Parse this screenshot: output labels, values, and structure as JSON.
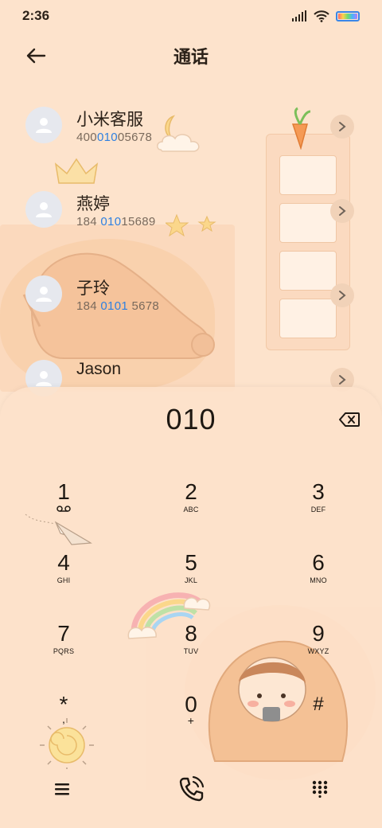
{
  "status_bar": {
    "time": "2:36",
    "icons": [
      "signal-icon",
      "wifi-icon",
      "battery-icon"
    ]
  },
  "header": {
    "title": "通话",
    "back_icon": "arrow-left-icon"
  },
  "contacts": [
    {
      "name": "小米客服",
      "number_pre": "400",
      "number_hl": "010",
      "number_post": "05678"
    },
    {
      "name": "燕婷",
      "number_pre": "184 ",
      "number_hl": "010",
      "number_post": "15689"
    },
    {
      "name": "子玲",
      "number_pre": "184 ",
      "number_hl": "0101",
      "number_post": " 5678"
    },
    {
      "name": "Jason",
      "number_pre": "",
      "number_hl": "",
      "number_post": ""
    }
  ],
  "dialpad": {
    "dialed_number": "010",
    "keys": [
      {
        "digit": "1",
        "letters": ""
      },
      {
        "digit": "2",
        "letters": "ABC"
      },
      {
        "digit": "3",
        "letters": "DEF"
      },
      {
        "digit": "4",
        "letters": "GHI"
      },
      {
        "digit": "5",
        "letters": "JKL"
      },
      {
        "digit": "6",
        "letters": "MNO"
      },
      {
        "digit": "7",
        "letters": "PQRS"
      },
      {
        "digit": "8",
        "letters": "TUV"
      },
      {
        "digit": "9",
        "letters": "WXYZ"
      },
      {
        "digit": "*",
        "letters": ","
      },
      {
        "digit": "0",
        "letters": "+"
      },
      {
        "digit": "#",
        "letters": ""
      }
    ]
  },
  "bottom_bar": {
    "icons": [
      "menu-icon",
      "call-icon",
      "dialpad-icon"
    ]
  },
  "colors": {
    "background": "#fde3cc",
    "highlight": "#2f80e0",
    "text": "#2b2118"
  }
}
